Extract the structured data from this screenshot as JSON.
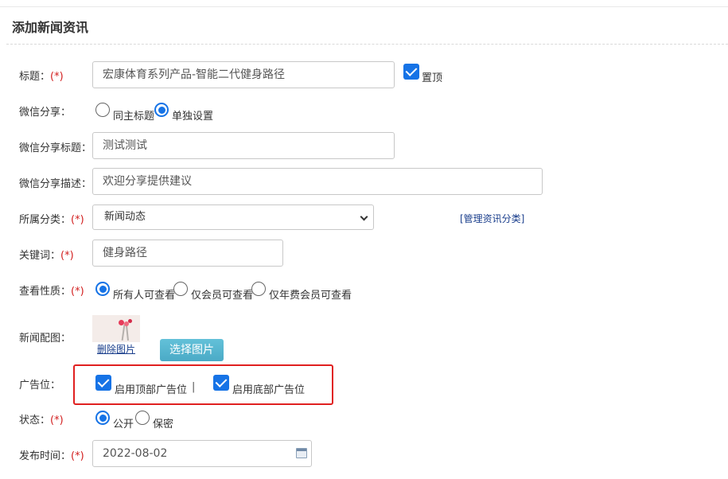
{
  "page": {
    "title": "添加新闻资讯"
  },
  "form": {
    "required_mark": "(*)",
    "title": {
      "label": "标题：",
      "value": "宏康体育系列产品-智能二代健身路径",
      "pin_label": "置顶",
      "pin_checked": true
    },
    "wechat_share": {
      "label": "微信分享：",
      "options": [
        "同主标题",
        "单独设置"
      ],
      "selected": "单独设置"
    },
    "wechat_share_title": {
      "label": "微信分享标题：",
      "value": "测试测试"
    },
    "wechat_share_desc": {
      "label": "微信分享描述：",
      "value": "欢迎分享提供建议"
    },
    "category": {
      "label": "所属分类：",
      "selected": "新闻动态",
      "manage_link": "[管理资讯分类]"
    },
    "keywords": {
      "label": "关键词：",
      "value": "健身路径"
    },
    "visibility": {
      "label": "查看性质：",
      "options": [
        "所有人可查看",
        "仅会员可查看",
        "仅年费会员可查看"
      ],
      "selected": "所有人可查看"
    },
    "news_image": {
      "label": "新闻配图：",
      "delete_link": "删除图片",
      "choose_button": "选择图片"
    },
    "ad_slot": {
      "label": "广告位：",
      "top_label": "启用顶部广告位",
      "top_checked": true,
      "separator": "|",
      "bottom_label": "启用底部广告位",
      "bottom_checked": true
    },
    "status": {
      "label": "状态：",
      "options": [
        "公开",
        "保密"
      ],
      "selected": "公开"
    },
    "publish_time": {
      "label": "发布时间：",
      "value": "2022-08-02"
    }
  },
  "colors": {
    "accent": "#1673e6",
    "required": "#d21e1e",
    "highlight_box": "#e02020",
    "button": "#4aaac6",
    "link": "#1a3e8c"
  }
}
